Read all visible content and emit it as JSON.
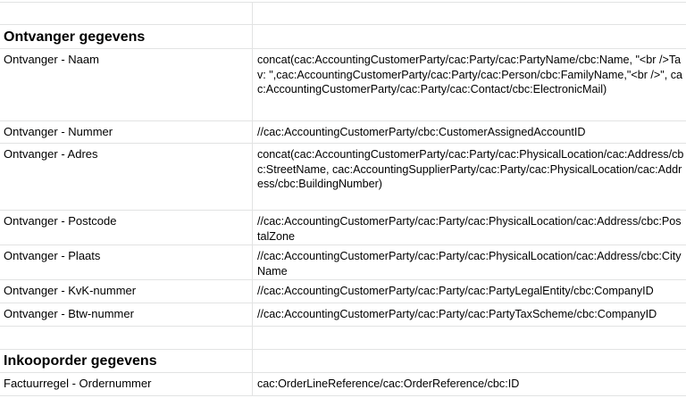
{
  "sections": {
    "receiver_title": "Ontvanger gegevens",
    "purchase_order_title": "Inkooporder gegevens"
  },
  "rows": [
    {
      "label": "Ontvanger - Naam",
      "value": "concat(cac:AccountingCustomerParty/cac:Party/cac:PartyName/cbc:Name, \"<br />Tav: \",cac:AccountingCustomerParty/cac:Party/cac:Person/cbc:FamilyName,\"<br />\", cac:AccountingCustomerParty/cac:Party/cac:Contact/cbc:ElectronicMail)"
    },
    {
      "label": "Ontvanger - Nummer",
      "value": "//cac:AccountingCustomerParty/cbc:CustomerAssignedAccountID"
    },
    {
      "label": "Ontvanger - Adres",
      "value": "concat(cac:AccountingCustomerParty/cac:Party/cac:PhysicalLocation/cac:Address/cbc:StreetName, cac:AccountingSupplierParty/cac:Party/cac:PhysicalLocation/cac:Address/cbc:BuildingNumber)"
    },
    {
      "label": "Ontvanger - Postcode",
      "value": "//cac:AccountingCustomerParty/cac:Party/cac:PhysicalLocation/cac:Address/cbc:PostalZone"
    },
    {
      "label": "Ontvanger - Plaats",
      "value": "//cac:AccountingCustomerParty/cac:Party/cac:PhysicalLocation/cac:Address/cbc:CityName"
    },
    {
      "label": "Ontvanger - KvK-nummer",
      "value": "//cac:AccountingCustomerParty/cac:Party/cac:PartyLegalEntity/cbc:CompanyID"
    },
    {
      "label": "Ontvanger - Btw-nummer",
      "value": "//cac:AccountingCustomerParty/cac:Party/cac:PartyTaxScheme/cbc:CompanyID"
    },
    {
      "label": "Factuurregel - Ordernummer",
      "value": "cac:OrderLineReference/cac:OrderReference/cbc:ID"
    }
  ],
  "colors": {
    "gridline": "#e2e3e3",
    "text": "#000000",
    "background": "#ffffff"
  }
}
